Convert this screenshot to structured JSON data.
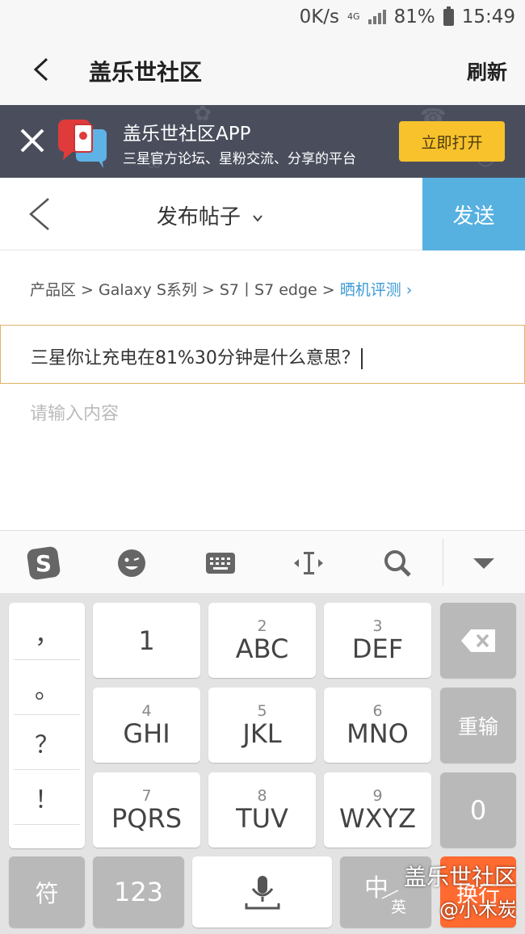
{
  "status": {
    "speed": "0K/s",
    "net": "4G",
    "battery": "81%",
    "time": "15:49"
  },
  "appbar": {
    "title": "盖乐世社区",
    "refresh": "刷新"
  },
  "banner": {
    "title": "盖乐世社区APP",
    "subtitle": "三星官方论坛、星粉交流、分享的平台",
    "open_label": "立即打开"
  },
  "post": {
    "header_title": "发布帖子",
    "send_label": "发送"
  },
  "breadcrumb": {
    "path": "产品区 > Galaxy S系列 > S7丨S7 edge > ",
    "current": "晒机评测"
  },
  "title_input": {
    "value": "三星你让充电在81%30分钟是什么意思？"
  },
  "content_input": {
    "placeholder": "请输入内容"
  },
  "keyboard": {
    "punctuation": [
      "，",
      "。",
      "？",
      "！"
    ],
    "keys": [
      {
        "num": "",
        "label": "1"
      },
      {
        "num": "2",
        "label": "ABC"
      },
      {
        "num": "3",
        "label": "DEF"
      },
      {
        "num": "4",
        "label": "GHI"
      },
      {
        "num": "5",
        "label": "JKL"
      },
      {
        "num": "6",
        "label": "MNO"
      },
      {
        "num": "7",
        "label": "PQRS"
      },
      {
        "num": "8",
        "label": "TUV"
      },
      {
        "num": "9",
        "label": "WXYZ"
      }
    ],
    "retype": "重输",
    "zero": "0",
    "symbol": "符",
    "num_mode": "123",
    "lang_main": "中",
    "lang_sub": "英",
    "enter": "换行"
  },
  "watermark": {
    "line1": "盖乐世社区",
    "line2": "@小木炭"
  }
}
